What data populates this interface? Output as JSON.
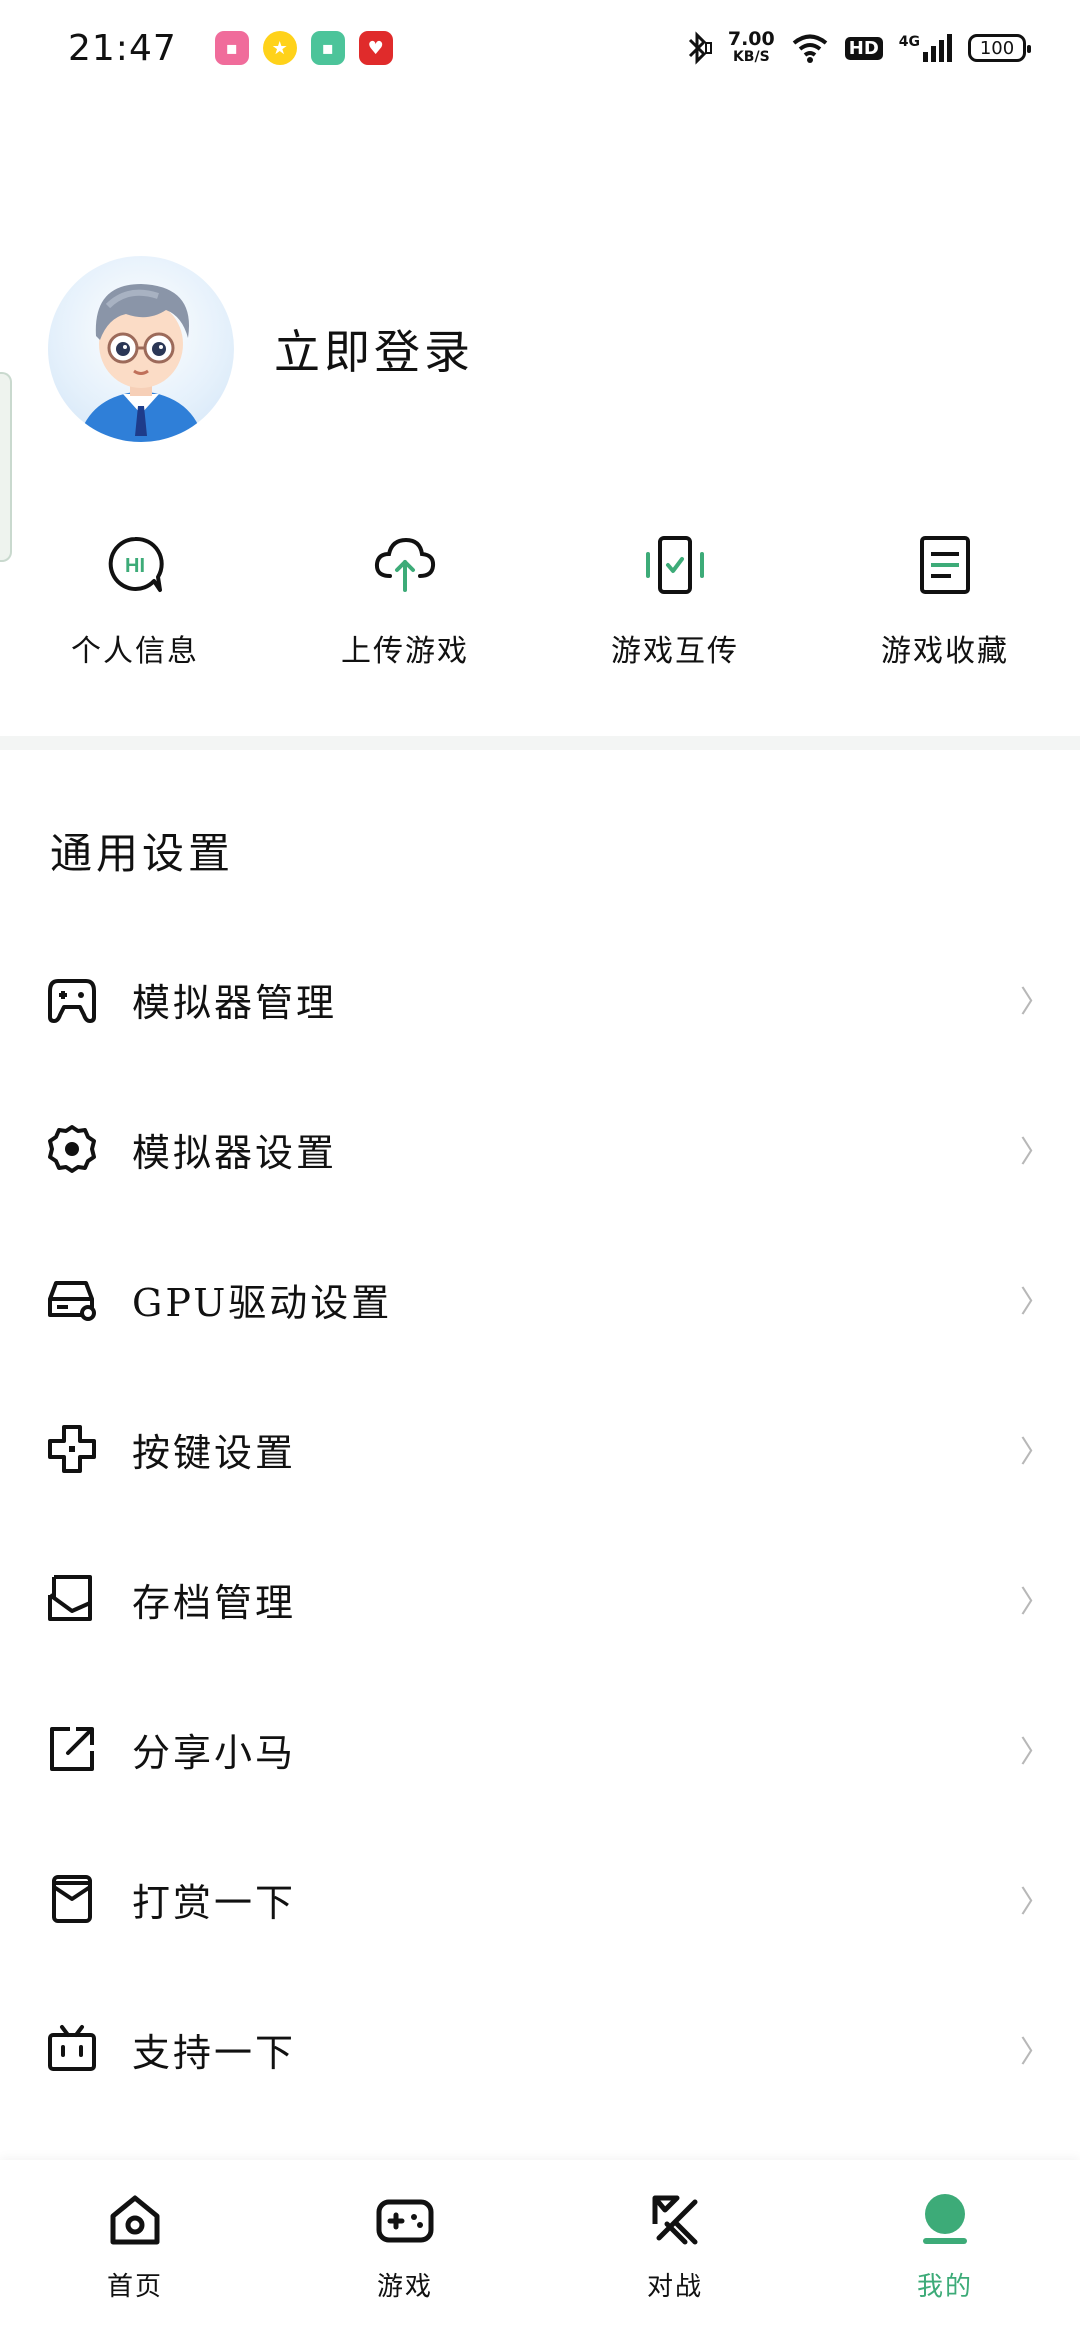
{
  "status_bar": {
    "time": "21:47",
    "network_speed_value": "7.00",
    "network_speed_unit": "KB/S",
    "hd_label": "HD",
    "signal_label": "4G",
    "battery": "100"
  },
  "profile": {
    "login_label": "立即登录"
  },
  "quick_actions": [
    {
      "label": "个人信息",
      "icon": "hi-chat-icon"
    },
    {
      "label": "上传游戏",
      "icon": "cloud-upload-icon"
    },
    {
      "label": "游戏互传",
      "icon": "phone-transfer-icon"
    },
    {
      "label": "游戏收藏",
      "icon": "document-icon"
    }
  ],
  "settings": {
    "title": "通用设置",
    "items": [
      {
        "label": "模拟器管理",
        "icon": "gamepad-icon"
      },
      {
        "label": "模拟器设置",
        "icon": "gear-icon"
      },
      {
        "label": "GPU驱动设置",
        "icon": "gpu-drive-icon"
      },
      {
        "label": "按键设置",
        "icon": "dpad-icon"
      },
      {
        "label": "存档管理",
        "icon": "save-box-icon"
      },
      {
        "label": "分享小马",
        "icon": "share-icon"
      },
      {
        "label": "打赏一下",
        "icon": "reward-envelope-icon"
      },
      {
        "label": "支持一下",
        "icon": "tv-icon"
      }
    ],
    "chevron": "〉"
  },
  "bottom_nav": [
    {
      "label": "首页",
      "icon": "home-icon",
      "active": false
    },
    {
      "label": "游戏",
      "icon": "gamepad-icon",
      "active": false
    },
    {
      "label": "对战",
      "icon": "battle-icon",
      "active": false
    },
    {
      "label": "我的",
      "icon": "profile-icon",
      "active": true
    }
  ],
  "colors": {
    "accent": "#3dab78",
    "chevron": "#b8b8b8"
  }
}
